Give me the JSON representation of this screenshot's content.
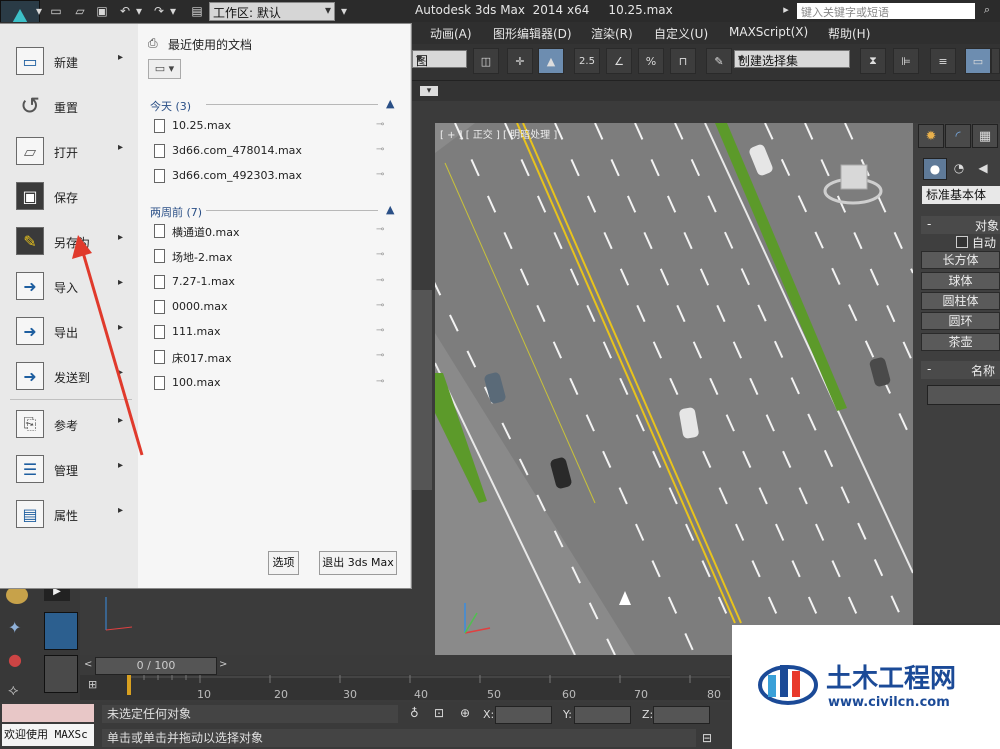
{
  "titlebar": {
    "title": "Autodesk 3ds Max  2014 x64     10.25.max",
    "workspace_label": "工作区: 默认",
    "search_placeholder": "键入关键字或短语"
  },
  "menubar": {
    "items": [
      "动画(A)",
      "图形编辑器(D)",
      "渲染(R)",
      "自定义(U)",
      "MAXScript(X)",
      "帮助(H)"
    ]
  },
  "toolbar": {
    "view_select": "图",
    "selection_set": "创建选择集",
    "snap_25": "2.5",
    "snap_pct": "%"
  },
  "viewport": {
    "label": "[ + ] [ 正交 ] [ 明暗处理 ]"
  },
  "command_panel": {
    "dropdown": "标准基本体",
    "rollout_object_type": "对象",
    "autogrid": "自动",
    "buttons": [
      "长方体",
      "球体",
      "圆柱体",
      "圆环",
      "茶壶"
    ],
    "rollout_name": "名称"
  },
  "app_menu": {
    "items": [
      {
        "label": "新建",
        "icon": "new-file-icon",
        "arrow": true
      },
      {
        "label": "重置",
        "icon": "reset-icon",
        "arrow": false
      },
      {
        "label": "打开",
        "icon": "open-folder-icon",
        "arrow": true
      },
      {
        "label": "保存",
        "icon": "save-disk-icon",
        "arrow": false
      },
      {
        "label": "另存为",
        "icon": "save-as-icon",
        "arrow": true
      },
      {
        "label": "导入",
        "icon": "import-icon",
        "arrow": true
      },
      {
        "label": "导出",
        "icon": "export-icon",
        "arrow": true
      },
      {
        "label": "发送到",
        "icon": "send-to-icon",
        "arrow": true
      },
      {
        "label": "参考",
        "icon": "reference-icon",
        "arrow": true
      },
      {
        "label": "管理",
        "icon": "manage-icon",
        "arrow": true
      },
      {
        "label": "属性",
        "icon": "properties-icon",
        "arrow": true
      }
    ],
    "recent_title": "最近使用的文档",
    "groups": [
      {
        "title": "今天 (3)",
        "files": [
          "10.25.max",
          "3d66.com_478014.max",
          "3d66.com_492303.max"
        ]
      },
      {
        "title": "两周前 (7)",
        "files": [
          "横通道0.max",
          "场地-2.max",
          "7.27-1.max",
          "0000.max",
          "111.max",
          "床017.max",
          "100.max"
        ]
      }
    ],
    "options_button": "选项",
    "exit_button": "退出 3ds Max"
  },
  "timeline": {
    "slider": "0 / 100",
    "ticks": [
      "10",
      "20",
      "30",
      "40",
      "50",
      "60",
      "70",
      "80"
    ]
  },
  "status": {
    "welcome": "欢迎使用 MAXSc",
    "line1": "未选定任何对象",
    "line2": "单击或单击并拖动以选择对象",
    "x_label": "X:",
    "y_label": "Y:",
    "z_label": "Z:"
  },
  "watermark": {
    "name": "土木工程网",
    "url": "www.civilcn.com"
  },
  "colors": {
    "accent": "#2a4f86",
    "road": "#8a8a8a",
    "lane_yellow": "#e8c31c",
    "grass": "#5c9a2a",
    "annotation_red": "#e03a2c"
  }
}
